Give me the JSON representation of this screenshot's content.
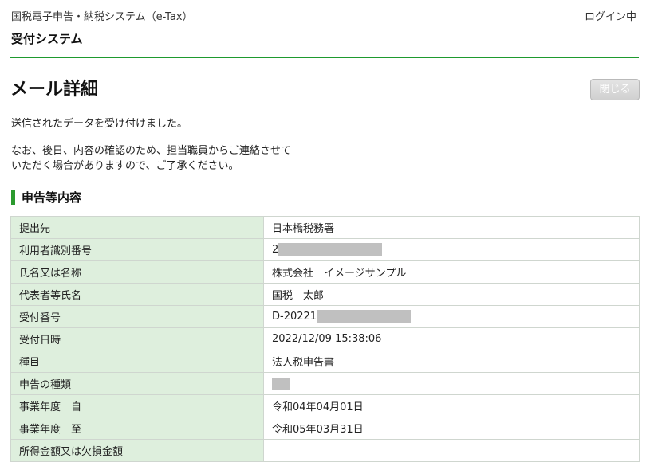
{
  "header": {
    "site_name": "国税電子申告・納税システム（e-Tax）",
    "login_status": "ログイン中",
    "system_title": "受付システム"
  },
  "page": {
    "title": "メール詳細",
    "close_label": "閉じる",
    "message1": "送信されたデータを受け付けました。",
    "message2_line1": "なお、後日、内容の確認のため、担当職員からご連絡させて",
    "message2_line2": "いただく場合がありますので、ご了承ください。"
  },
  "section": {
    "title": "申告等内容"
  },
  "rows": [
    {
      "label": "提出先",
      "value": "日本橋税務署"
    },
    {
      "label": "利用者識別番号",
      "value": "2"
    },
    {
      "label": "氏名又は名称",
      "value": "株式会社　イメージサンプル"
    },
    {
      "label": "代表者等氏名",
      "value": "国税　太郎"
    },
    {
      "label": "受付番号",
      "value": "D-20221"
    },
    {
      "label": "受付日時",
      "value": "2022/12/09 15:38:06"
    },
    {
      "label": "種目",
      "value": "法人税申告書"
    },
    {
      "label": "申告の種類",
      "value": ""
    },
    {
      "label": "事業年度　自",
      "value": "令和04年04月01日"
    },
    {
      "label": "事業年度　至",
      "value": "令和05年03月31日"
    },
    {
      "label": "所得金額又は欠損金額",
      "value": ""
    }
  ],
  "colors": {
    "accent": "#1e9a2e",
    "label_bg": "#deefdd"
  }
}
